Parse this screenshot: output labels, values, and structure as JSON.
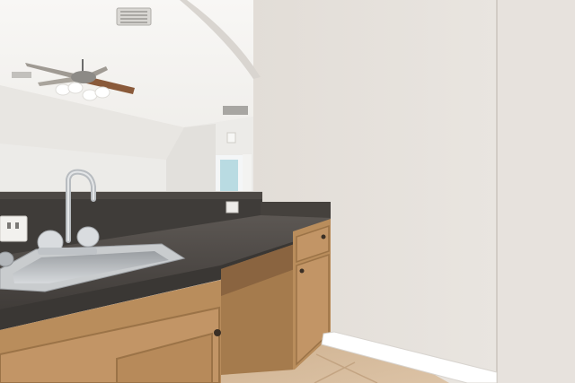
{
  "scene": {
    "kind": "photo",
    "description_colors": {
      "wall": "#e6e1dc",
      "wall_shadow": "#d7d1cb",
      "ceiling": "#f3f2ef",
      "countertop": "#4d4945",
      "backsplash": "#3f3c39",
      "cabinet": "#b98d5c",
      "cabinet_dark": "#9b7347",
      "floor": "#d3b797",
      "baseboard": "#ffffff",
      "sink": "#bfc2c5",
      "fan_blade": "#8a5a3a",
      "door_blue": "#b9dbe2"
    }
  }
}
